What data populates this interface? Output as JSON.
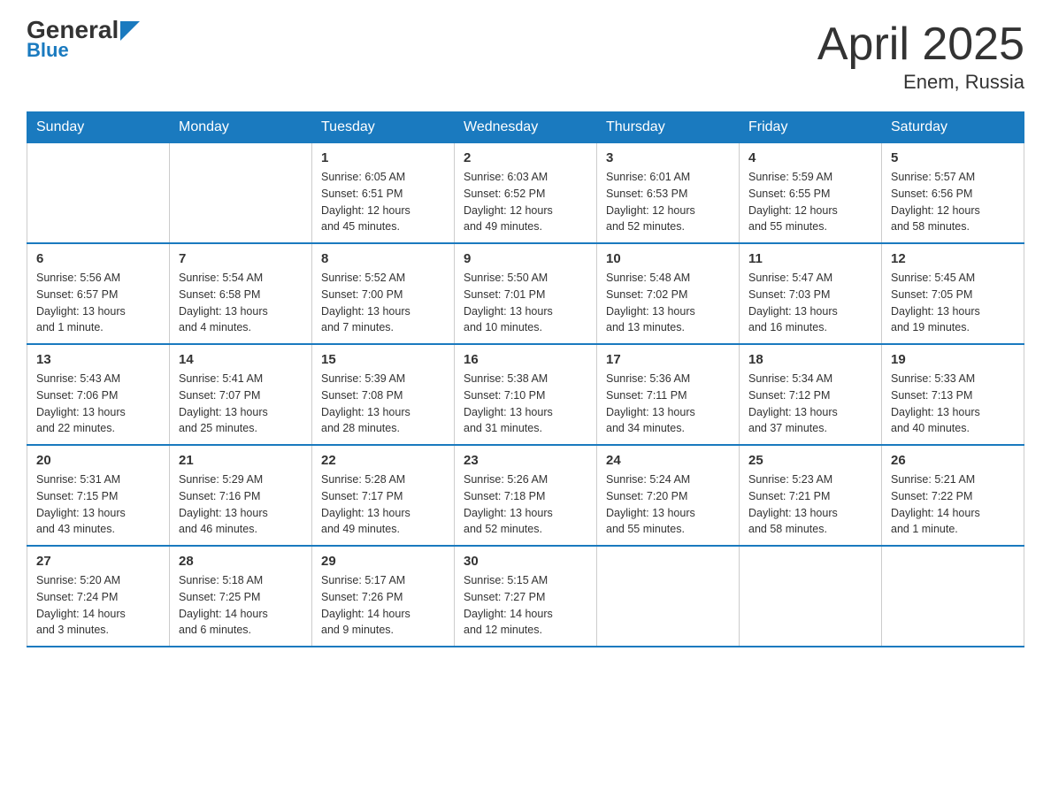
{
  "header": {
    "logo_general": "General",
    "logo_blue": "Blue",
    "title": "April 2025",
    "subtitle": "Enem, Russia"
  },
  "weekdays": [
    "Sunday",
    "Monday",
    "Tuesday",
    "Wednesday",
    "Thursday",
    "Friday",
    "Saturday"
  ],
  "weeks": [
    [
      {
        "day": "",
        "info": ""
      },
      {
        "day": "",
        "info": ""
      },
      {
        "day": "1",
        "info": "Sunrise: 6:05 AM\nSunset: 6:51 PM\nDaylight: 12 hours\nand 45 minutes."
      },
      {
        "day": "2",
        "info": "Sunrise: 6:03 AM\nSunset: 6:52 PM\nDaylight: 12 hours\nand 49 minutes."
      },
      {
        "day": "3",
        "info": "Sunrise: 6:01 AM\nSunset: 6:53 PM\nDaylight: 12 hours\nand 52 minutes."
      },
      {
        "day": "4",
        "info": "Sunrise: 5:59 AM\nSunset: 6:55 PM\nDaylight: 12 hours\nand 55 minutes."
      },
      {
        "day": "5",
        "info": "Sunrise: 5:57 AM\nSunset: 6:56 PM\nDaylight: 12 hours\nand 58 minutes."
      }
    ],
    [
      {
        "day": "6",
        "info": "Sunrise: 5:56 AM\nSunset: 6:57 PM\nDaylight: 13 hours\nand 1 minute."
      },
      {
        "day": "7",
        "info": "Sunrise: 5:54 AM\nSunset: 6:58 PM\nDaylight: 13 hours\nand 4 minutes."
      },
      {
        "day": "8",
        "info": "Sunrise: 5:52 AM\nSunset: 7:00 PM\nDaylight: 13 hours\nand 7 minutes."
      },
      {
        "day": "9",
        "info": "Sunrise: 5:50 AM\nSunset: 7:01 PM\nDaylight: 13 hours\nand 10 minutes."
      },
      {
        "day": "10",
        "info": "Sunrise: 5:48 AM\nSunset: 7:02 PM\nDaylight: 13 hours\nand 13 minutes."
      },
      {
        "day": "11",
        "info": "Sunrise: 5:47 AM\nSunset: 7:03 PM\nDaylight: 13 hours\nand 16 minutes."
      },
      {
        "day": "12",
        "info": "Sunrise: 5:45 AM\nSunset: 7:05 PM\nDaylight: 13 hours\nand 19 minutes."
      }
    ],
    [
      {
        "day": "13",
        "info": "Sunrise: 5:43 AM\nSunset: 7:06 PM\nDaylight: 13 hours\nand 22 minutes."
      },
      {
        "day": "14",
        "info": "Sunrise: 5:41 AM\nSunset: 7:07 PM\nDaylight: 13 hours\nand 25 minutes."
      },
      {
        "day": "15",
        "info": "Sunrise: 5:39 AM\nSunset: 7:08 PM\nDaylight: 13 hours\nand 28 minutes."
      },
      {
        "day": "16",
        "info": "Sunrise: 5:38 AM\nSunset: 7:10 PM\nDaylight: 13 hours\nand 31 minutes."
      },
      {
        "day": "17",
        "info": "Sunrise: 5:36 AM\nSunset: 7:11 PM\nDaylight: 13 hours\nand 34 minutes."
      },
      {
        "day": "18",
        "info": "Sunrise: 5:34 AM\nSunset: 7:12 PM\nDaylight: 13 hours\nand 37 minutes."
      },
      {
        "day": "19",
        "info": "Sunrise: 5:33 AM\nSunset: 7:13 PM\nDaylight: 13 hours\nand 40 minutes."
      }
    ],
    [
      {
        "day": "20",
        "info": "Sunrise: 5:31 AM\nSunset: 7:15 PM\nDaylight: 13 hours\nand 43 minutes."
      },
      {
        "day": "21",
        "info": "Sunrise: 5:29 AM\nSunset: 7:16 PM\nDaylight: 13 hours\nand 46 minutes."
      },
      {
        "day": "22",
        "info": "Sunrise: 5:28 AM\nSunset: 7:17 PM\nDaylight: 13 hours\nand 49 minutes."
      },
      {
        "day": "23",
        "info": "Sunrise: 5:26 AM\nSunset: 7:18 PM\nDaylight: 13 hours\nand 52 minutes."
      },
      {
        "day": "24",
        "info": "Sunrise: 5:24 AM\nSunset: 7:20 PM\nDaylight: 13 hours\nand 55 minutes."
      },
      {
        "day": "25",
        "info": "Sunrise: 5:23 AM\nSunset: 7:21 PM\nDaylight: 13 hours\nand 58 minutes."
      },
      {
        "day": "26",
        "info": "Sunrise: 5:21 AM\nSunset: 7:22 PM\nDaylight: 14 hours\nand 1 minute."
      }
    ],
    [
      {
        "day": "27",
        "info": "Sunrise: 5:20 AM\nSunset: 7:24 PM\nDaylight: 14 hours\nand 3 minutes."
      },
      {
        "day": "28",
        "info": "Sunrise: 5:18 AM\nSunset: 7:25 PM\nDaylight: 14 hours\nand 6 minutes."
      },
      {
        "day": "29",
        "info": "Sunrise: 5:17 AM\nSunset: 7:26 PM\nDaylight: 14 hours\nand 9 minutes."
      },
      {
        "day": "30",
        "info": "Sunrise: 5:15 AM\nSunset: 7:27 PM\nDaylight: 14 hours\nand 12 minutes."
      },
      {
        "day": "",
        "info": ""
      },
      {
        "day": "",
        "info": ""
      },
      {
        "day": "",
        "info": ""
      }
    ]
  ]
}
